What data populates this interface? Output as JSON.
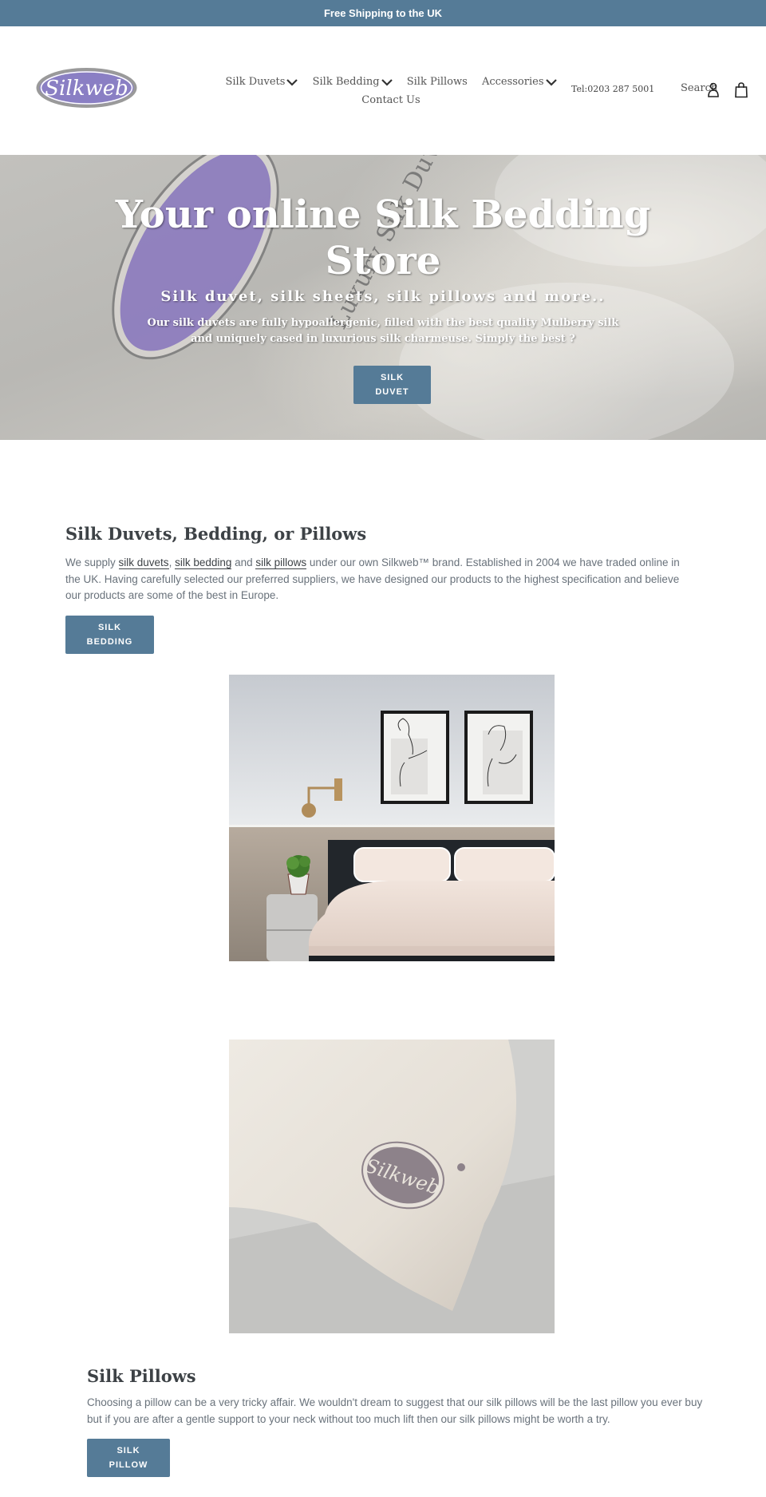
{
  "announcement": {
    "text": "Free Shipping to the UK"
  },
  "header": {
    "logo_text": "Silkweb",
    "nav": [
      {
        "label": "Silk Duvets",
        "has_dropdown": true
      },
      {
        "label": "Silk Bedding",
        "has_dropdown": true
      },
      {
        "label": "Silk Pillows",
        "has_dropdown": false
      },
      {
        "label": "Accessories",
        "has_dropdown": true
      },
      {
        "label": "Contact Us",
        "has_dropdown": false
      }
    ],
    "tel": "Tel:0203 287 5001",
    "search_label": "Search",
    "icons": {
      "account": "account-icon",
      "cart": "cart-icon"
    }
  },
  "hero": {
    "title": "Your online Silk Bedding Store",
    "subtitle": "Silk duvet, silk sheets, silk pillows and more..",
    "description": "Our silk duvets are fully hypoallergenic, filled with the best quality Mulberry silk and uniquely cased in luxurious silk charmeuse. Simply the best ?",
    "button_label": "SILK\nDUVET",
    "image_label": "Luxury Silk Duvet"
  },
  "intro": {
    "title": "Silk Duvets, Bedding, or Pillows",
    "text_parts": {
      "p1": "We supply ",
      "link1": "silk duvets",
      "p2": ", ",
      "link2": "silk bedding",
      "p3": " and ",
      "link3": "silk pillows",
      "p4": " under our own Silkweb™ brand. Established in 2004 we have traded online in the UK. Having carefully selected our preferred suppliers, we have designed our products to the highest specification and believe our products are some of the best in Europe."
    },
    "button_label": "SILK\nBEDDING"
  },
  "images": {
    "bedroom_alt": "Bedroom with silk bedding",
    "pillow_alt": "Silkweb silk pillow"
  },
  "pillows": {
    "title": "Silk Pillows",
    "text": "Choosing a pillow can be a very tricky affair. We wouldn't dream to suggest that our silk pillows will be the last pillow you ever buy but if you are after a gentle support to your neck without too much lift then our silk pillows might be worth a try.",
    "button_label": "SILK\nPILLOW"
  },
  "colors": {
    "accent": "#557b97",
    "heading": "#3d4246",
    "body_text": "#69727b",
    "logo_purple": "#8a7fc4"
  }
}
